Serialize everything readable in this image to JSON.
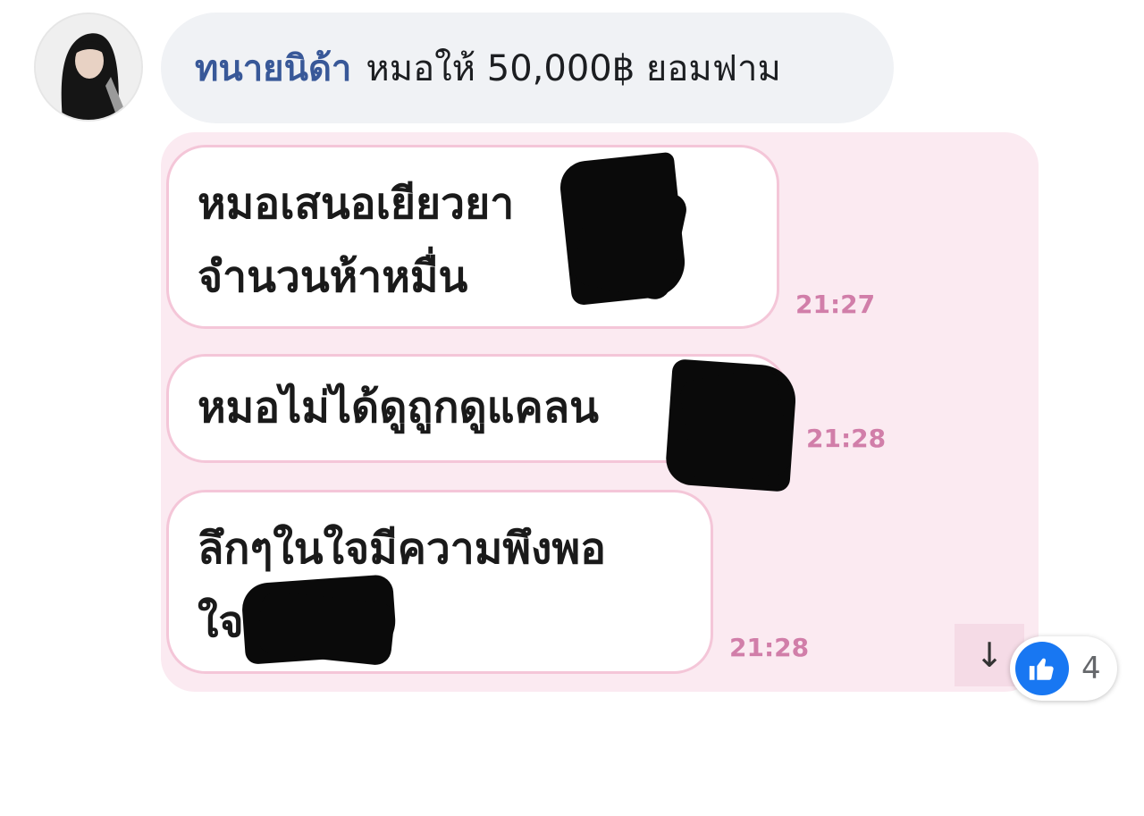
{
  "comment": {
    "author": "ทนายนิด้า",
    "text": "หมอให้ 50,000฿ ยอมฟาม"
  },
  "attachment": {
    "messages": [
      {
        "lines": [
          "หมอเสนอเยียวยา",
          "จำนวนห้าหมื่น"
        ],
        "time": "21:27"
      },
      {
        "lines": [
          "หมอไม่ได้ดูถูกดูแคลน"
        ],
        "time": "21:28"
      },
      {
        "lines": [
          "ลึกๆในใจมีความพึงพอ",
          "ใจ"
        ],
        "time": "21:28"
      }
    ],
    "scroll_icon": "arrow-down-icon",
    "scroll_glyph": "↓"
  },
  "reactions": {
    "icon": "like-icon",
    "count": "4"
  },
  "colors": {
    "author": "#385898",
    "comment_bg": "#f0f2f5",
    "attachment_bg": "#fbeaf1",
    "timestamp": "#d17ea9",
    "like": "#1877f2"
  }
}
